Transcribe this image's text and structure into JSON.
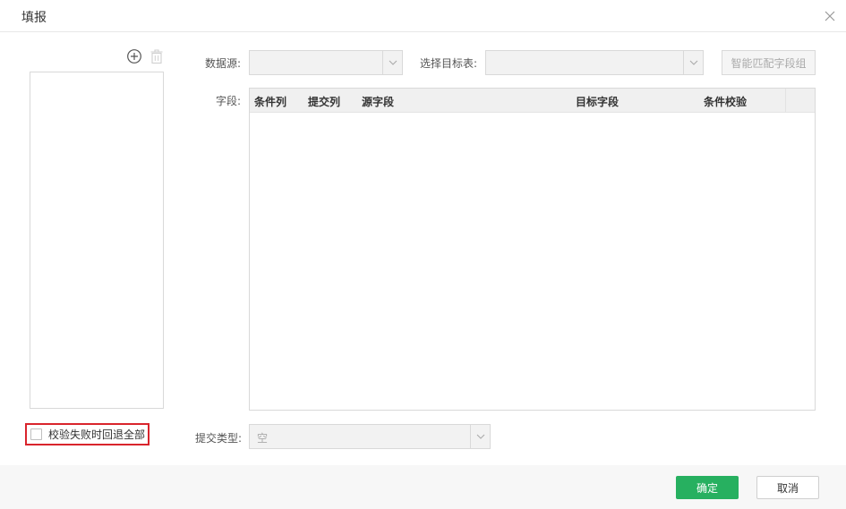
{
  "dialog": {
    "title": "填报"
  },
  "left_panel": {
    "rollback_label": "校验失败时回退全部",
    "rollback_checked": false
  },
  "form": {
    "datasource_label": "数据源:",
    "datasource_value": "",
    "target_label": "选择目标表:",
    "target_value": "",
    "match_button": "智能匹配字段组",
    "fields_label": "字段:",
    "submit_type_label": "提交类型:",
    "submit_type_value": "空"
  },
  "table": {
    "columns": [
      "条件列",
      "提交列",
      "源字段",
      "目标字段",
      "条件校验"
    ],
    "rows": []
  },
  "footer": {
    "ok_label": "确定",
    "cancel_label": "取消"
  },
  "colors": {
    "primary": "#27b060",
    "highlight_border": "#d9242c"
  },
  "icons": {
    "close": "close-icon",
    "add": "add-circle-icon",
    "delete": "trash-icon",
    "dropdown": "chevron-down-icon"
  }
}
